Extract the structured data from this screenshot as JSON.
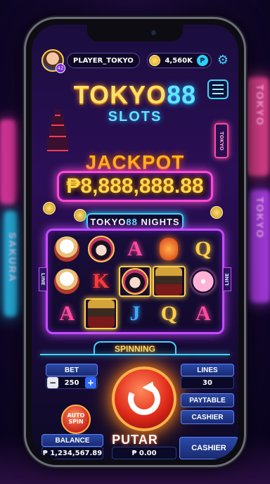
{
  "background": {
    "sign_left": "SAKURA",
    "sign_right_top": "TOKYO",
    "sign_right_bottom": "TOKYO"
  },
  "topbar": {
    "player_name": "PLAYER_TOKYO",
    "level": "42",
    "coins": "4,560K",
    "peso_symbol": "₱",
    "settings_icon": "gear-icon"
  },
  "title": {
    "word": "TOKYO",
    "number": "88",
    "subtitle": "SLOTS"
  },
  "jackpot": {
    "label": "JACKPOT",
    "amount": "₱8,888,888.88"
  },
  "banner": {
    "prefix": "TOKYO",
    "number": "88",
    "suffix": "NIGHTS"
  },
  "reels": {
    "rows": [
      [
        "lucky-cat",
        "geisha",
        "A",
        "lantern",
        "Q"
      ],
      [
        "lucky-cat",
        "K",
        "geisha",
        "samurai",
        "sakura"
      ],
      [
        "A",
        "samurai",
        "J",
        "Q",
        "A"
      ]
    ],
    "side_left": "LINE",
    "side_right": "LINE"
  },
  "status": "SPINNING",
  "bet": {
    "label": "BET",
    "value": "250",
    "minus": "−",
    "plus": "+"
  },
  "auto_spin": "AUTO SPIN",
  "spin_label": "PUTAR",
  "win_value": "₱ 0.00",
  "balance": {
    "label": "BALANCE",
    "value": "₱ 1,234,567.89"
  },
  "lines": {
    "label": "LINES",
    "value": "30"
  },
  "paytable_label": "PAYTABLE",
  "cashier_label": "CASHIER",
  "cashier_big_label": "CASHIER"
}
